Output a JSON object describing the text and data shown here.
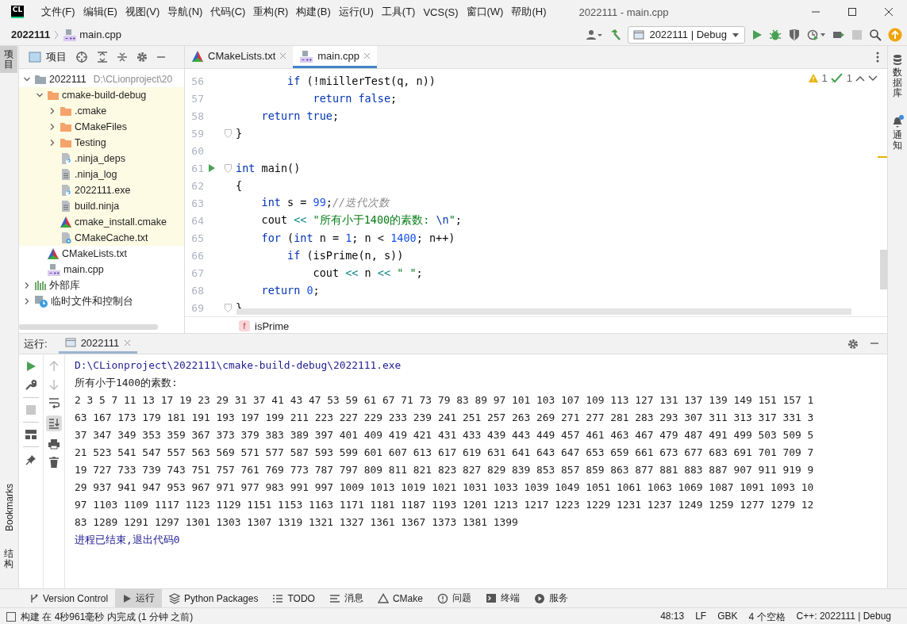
{
  "menu_bar": {
    "logo": "CL",
    "items": [
      "文件(F)",
      "编辑(E)",
      "视图(V)",
      "导航(N)",
      "代码(C)",
      "重构(R)",
      "构建(B)",
      "运行(U)",
      "工具(T)",
      "VCS(S)",
      "窗口(W)",
      "帮助(H)"
    ],
    "title": "2022111 - main.cpp"
  },
  "nav_bar": {
    "breadcrumbs": [
      {
        "label": "2022111",
        "kind": "project"
      },
      {
        "label": "main.cpp",
        "kind": "cpp"
      }
    ],
    "run_config": "2022111 | Debug"
  },
  "left_strip": {
    "top": [
      {
        "label": "项目",
        "selected": true
      }
    ],
    "bottom": [
      {
        "label": "Bookmarks",
        "selected": false
      },
      {
        "label": "结构",
        "selected": false
      }
    ]
  },
  "right_strip": [
    {
      "label": "数据库",
      "kind": "database",
      "has_notification": false
    },
    {
      "label": "通知",
      "kind": "bell",
      "has_notification": true
    }
  ],
  "project_panel": {
    "title": "项目",
    "tree": [
      {
        "name": "2022111",
        "path": "D:\\CLionproject\\20",
        "kind": "folder",
        "expanded": true,
        "children": [
          {
            "name": "cmake-build-debug",
            "kind": "folder-excluded",
            "expanded": true,
            "excluded": true,
            "children": [
              {
                "name": ".cmake",
                "kind": "folder-excluded",
                "expanded": false
              },
              {
                "name": "CMakeFiles",
                "kind": "folder-excluded",
                "expanded": false
              },
              {
                "name": "Testing",
                "kind": "folder-excluded",
                "expanded": false
              },
              {
                "name": ".ninja_deps",
                "kind": "file-unknown"
              },
              {
                "name": ".ninja_log",
                "kind": "file-text"
              },
              {
                "name": "2022111.exe",
                "kind": "file-unknown"
              },
              {
                "name": "build.ninja",
                "kind": "file-text"
              },
              {
                "name": "cmake_install.cmake",
                "kind": "cmake"
              },
              {
                "name": "CMakeCache.txt",
                "kind": "cmake-settings"
              }
            ]
          },
          {
            "name": "CMakeLists.txt",
            "kind": "cmake"
          },
          {
            "name": "main.cpp",
            "kind": "cpp"
          }
        ]
      },
      {
        "name": "外部库",
        "kind": "library",
        "expanded": false
      },
      {
        "name": "临时文件和控制台",
        "kind": "scratch",
        "expanded": false
      }
    ]
  },
  "editor": {
    "tabs": [
      {
        "label": "CMakeLists.txt",
        "kind": "cmake",
        "selected": false
      },
      {
        "label": "main.cpp",
        "kind": "cpp",
        "selected": true
      }
    ],
    "inspections": {
      "warnings": "1",
      "weak_warnings": "1"
    },
    "lines": [
      {
        "number": "56",
        "run": false,
        "fold": false,
        "tokens": [
          {
            "kind": "keyword",
            "text": "        if"
          },
          {
            "kind": "plain",
            "text": " (!miillerTest(q, n))"
          }
        ]
      },
      {
        "number": "57",
        "run": false,
        "fold": false,
        "tokens": [
          {
            "kind": "keyword",
            "text": "            return false"
          },
          {
            "kind": "plain",
            "text": ";"
          }
        ]
      },
      {
        "number": "58",
        "run": false,
        "fold": false,
        "tokens": [
          {
            "kind": "keyword",
            "text": "    return true"
          },
          {
            "kind": "plain",
            "text": ";"
          }
        ]
      },
      {
        "number": "59",
        "run": false,
        "fold": true,
        "tokens": [
          {
            "kind": "plain",
            "text": "}"
          }
        ]
      },
      {
        "number": "60",
        "run": false,
        "fold": false
      },
      {
        "number": "61",
        "run": true,
        "fold": true,
        "tokens": [
          {
            "kind": "keyword",
            "text": "int"
          },
          {
            "kind": "plain",
            "text": " main()"
          }
        ]
      },
      {
        "number": "62",
        "run": false,
        "fold": false,
        "tokens": [
          {
            "kind": "plain",
            "text": "{"
          }
        ]
      },
      {
        "number": "63",
        "run": false,
        "fold": false,
        "tokens": [
          {
            "kind": "keyword",
            "text": "    int"
          },
          {
            "kind": "plain",
            "text": " s = "
          },
          {
            "kind": "number",
            "text": "99"
          },
          {
            "kind": "plain",
            "text": ";"
          },
          {
            "kind": "comment",
            "text": "//迭代次数"
          }
        ]
      },
      {
        "number": "64",
        "run": false,
        "fold": false,
        "tokens": [
          {
            "kind": "plain",
            "text": "    cout "
          },
          {
            "kind": "operator",
            "text": "<< "
          },
          {
            "kind": "string",
            "text": "\"所有小于1400的素数: "
          },
          {
            "kind": "escape",
            "text": "\\n"
          },
          {
            "kind": "string",
            "text": "\""
          },
          {
            "kind": "plain",
            "text": ";"
          }
        ]
      },
      {
        "number": "65",
        "run": false,
        "fold": false,
        "tokens": [
          {
            "kind": "keyword",
            "text": "    for"
          },
          {
            "kind": "plain",
            "text": " ("
          },
          {
            "kind": "keyword",
            "text": "int"
          },
          {
            "kind": "plain",
            "text": " n = "
          },
          {
            "kind": "number",
            "text": "1"
          },
          {
            "kind": "plain",
            "text": "; n < "
          },
          {
            "kind": "number",
            "text": "1400"
          },
          {
            "kind": "plain",
            "text": "; n++)"
          }
        ]
      },
      {
        "number": "66",
        "run": false,
        "fold": false,
        "tokens": [
          {
            "kind": "keyword",
            "text": "        if"
          },
          {
            "kind": "plain",
            "text": " (isPrime(n, s))"
          }
        ]
      },
      {
        "number": "67",
        "run": false,
        "fold": false,
        "tokens": [
          {
            "kind": "plain",
            "text": "            cout "
          },
          {
            "kind": "operator",
            "text": "<<"
          },
          {
            "kind": "plain",
            "text": " n "
          },
          {
            "kind": "operator",
            "text": "<< "
          },
          {
            "kind": "string",
            "text": "\" \""
          },
          {
            "kind": "plain",
            "text": ";"
          }
        ]
      },
      {
        "number": "68",
        "run": false,
        "fold": false,
        "tokens": [
          {
            "kind": "keyword",
            "text": "    return"
          },
          {
            "kind": "number",
            "text": " 0"
          },
          {
            "kind": "plain",
            "text": ";"
          }
        ]
      },
      {
        "number": "69",
        "run": false,
        "fold": true,
        "tokens": [
          {
            "kind": "plain",
            "text": "}"
          }
        ]
      }
    ],
    "breadcrumb": {
      "icon_letter": "f",
      "label": "isPrime"
    }
  },
  "run_panel": {
    "label": "运行:",
    "tab": "2022111",
    "output": [
      {
        "kind": "path",
        "text": "D:\\CLionproject\\2022111\\cmake-build-debug\\2022111.exe"
      },
      {
        "kind": "text",
        "text": "所有小于1400的素数:"
      },
      {
        "kind": "text",
        "text": "2 3 5 7 11 13 17 19 23 29 31 37 41 43 47 53 59 61 67 71 73 79 83 89 97 101 103 107 109 113 127 131 137 139 149 151 157 1"
      },
      {
        "kind": "text",
        "text": "63 167 173 179 181 191 193 197 199 211 223 227 229 233 239 241 251 257 263 269 271 277 281 283 293 307 311 313 317 331 3"
      },
      {
        "kind": "text",
        "text": "37 347 349 353 359 367 373 379 383 389 397 401 409 419 421 431 433 439 443 449 457 461 463 467 479 487 491 499 503 509 5"
      },
      {
        "kind": "text",
        "text": "21 523 541 547 557 563 569 571 577 587 593 599 601 607 613 617 619 631 641 643 647 653 659 661 673 677 683 691 701 709 7"
      },
      {
        "kind": "text",
        "text": "19 727 733 739 743 751 757 761 769 773 787 797 809 811 821 823 827 829 839 853 857 859 863 877 881 883 887 907 911 919 9"
      },
      {
        "kind": "text",
        "text": "29 937 941 947 953 967 971 977 983 991 997 1009 1013 1019 1021 1031 1033 1039 1049 1051 1061 1063 1069 1087 1091 1093 10"
      },
      {
        "kind": "text",
        "text": "97 1103 1109 1117 1123 1129 1151 1153 1163 1171 1181 1187 1193 1201 1213 1217 1223 1229 1231 1237 1249 1259 1277 1279 12"
      },
      {
        "kind": "text",
        "text": "83 1289 1291 1297 1301 1303 1307 1319 1321 1327 1361 1367 1373 1381 1399"
      },
      {
        "kind": "exit",
        "text": "进程已结束,退出代码0"
      }
    ]
  },
  "tool_bar": [
    {
      "label": "Version Control",
      "kind": "vcs",
      "selected": false
    },
    {
      "label": "运行",
      "kind": "run",
      "selected": true
    },
    {
      "label": "Python Packages",
      "kind": "packages",
      "selected": false
    },
    {
      "label": "TODO",
      "kind": "todo",
      "selected": false
    },
    {
      "label": "消息",
      "kind": "messages",
      "selected": false
    },
    {
      "label": "CMake",
      "kind": "cmake",
      "selected": false
    },
    {
      "label": "问题",
      "kind": "problems",
      "selected": false
    },
    {
      "label": "终端",
      "kind": "terminal",
      "selected": false
    },
    {
      "label": "服务",
      "kind": "services",
      "selected": false
    }
  ],
  "status_bar": {
    "message": "构建 在 4秒961毫秒 内完成 (1 分钟 之前)",
    "items": [
      "48:13",
      "LF",
      "GBK",
      "4 个空格",
      "C++: 2022111 | Debug"
    ]
  }
}
